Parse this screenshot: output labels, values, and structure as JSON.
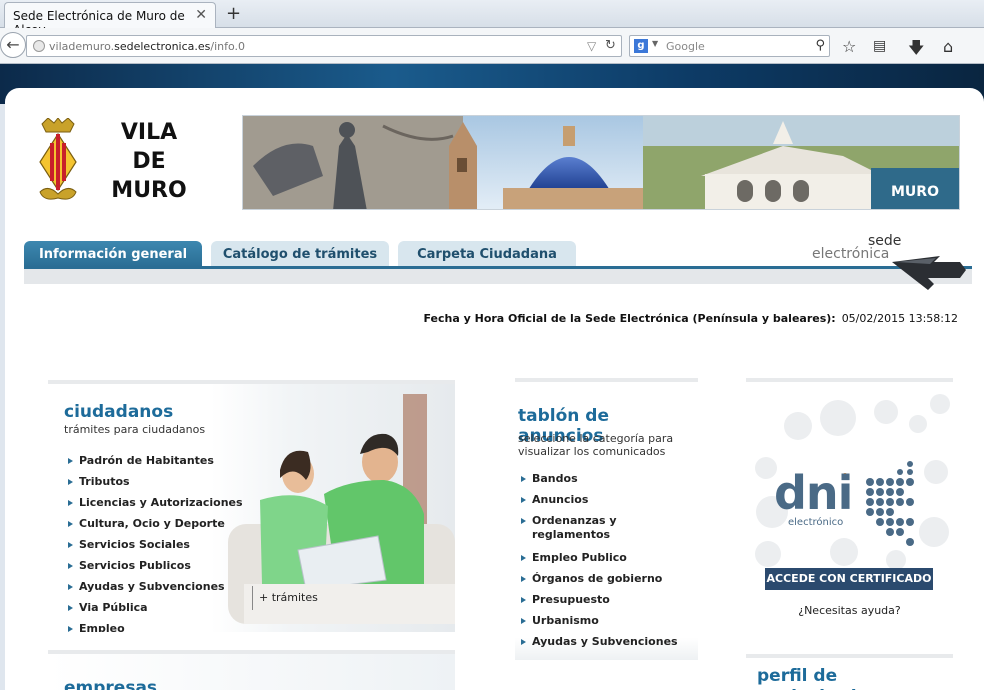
{
  "browser": {
    "tab_title": "Sede Electrónica de Muro de Alcoy",
    "tab_close": "✕",
    "new_tab": "+",
    "url_prefix": "vilademuro.",
    "url_host": "sedelectronica.es",
    "url_path": "/info.0",
    "search_placeholder": "Google"
  },
  "header": {
    "title_line1": "VILA",
    "title_line2": "DE",
    "title_line3": "MURO",
    "banner_logo": "MURO"
  },
  "nav": {
    "tabs": [
      {
        "label": "Información general",
        "active": true
      },
      {
        "label": "Catálogo de trámites",
        "active": false
      },
      {
        "label": "Carpeta Ciudadana",
        "active": false
      }
    ],
    "sede_line1": "sede",
    "sede_line2": "electrónica"
  },
  "datetime": {
    "label": "Fecha y Hora Oficial de la Sede Electrónica (Península y baleares):",
    "value": "05/02/2015 13:58:12"
  },
  "ciudadanos": {
    "heading": "ciudadanos",
    "subtitle": "trámites para ciudadanos",
    "items": [
      "Padrón de Habitantes",
      "Tributos",
      "Licencias y Autorizaciones",
      "Cultura, Ocio y Deporte",
      "Servicios Sociales",
      "Servicios Publicos",
      "Ayudas y Subvenciones",
      "Via Pública",
      "Empleo"
    ],
    "more": "+ trámites"
  },
  "tablon": {
    "heading": "tablón de anuncios",
    "subtitle_line1": "seleccione la categoría para",
    "subtitle_line2": "visualizar los comunicados",
    "items": [
      "Bandos",
      "Anuncios",
      "Ordenanzas y reglamentos",
      "Empleo Publico",
      "Órganos de gobierno",
      "Presupuesto",
      "Urbanismo",
      "Ayudas y Subvenciones"
    ]
  },
  "dni": {
    "logo_text": "dni",
    "logo_sub": "electrónico",
    "button": "ACCEDE CON CERTIFICADO",
    "help": "¿Necesitas ayuda?"
  },
  "perfil": {
    "heading": "perfil de contratante"
  },
  "empresas": {
    "heading": "empresas"
  },
  "colors": {
    "accent": "#2a6d94",
    "heading": "#1d6b9a",
    "dni_button": "#2b4a6e"
  }
}
